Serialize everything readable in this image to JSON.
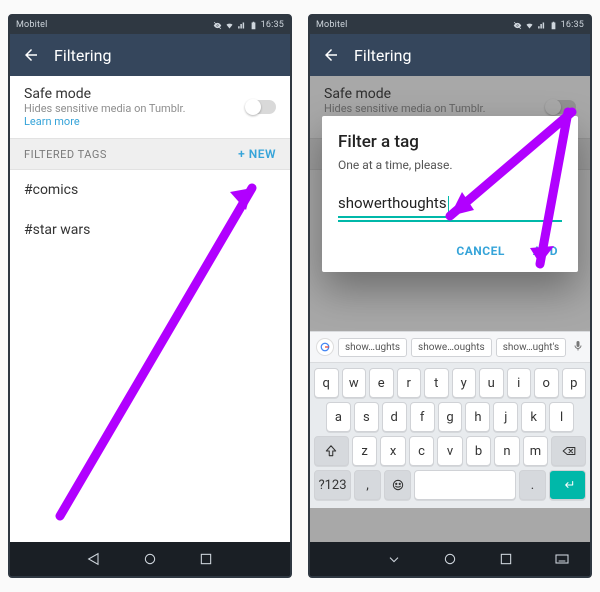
{
  "status": {
    "carrier": "Mobitel",
    "time": "16:35"
  },
  "appbar": {
    "title": "Filtering"
  },
  "safe": {
    "title": "Safe mode",
    "sub": "Hides sensitive media on Tumblr.",
    "learn": "Learn more"
  },
  "section": {
    "header": "FILTERED TAGS",
    "new": "+ NEW"
  },
  "tags": [
    "#comics",
    "#star wars"
  ],
  "dialog": {
    "title": "Filter a tag",
    "sub": "One at a time, please.",
    "value": "showerthoughts",
    "cancel": "CANCEL",
    "add": "ADD"
  },
  "suggest": [
    "show…ughts",
    "showe…oughts",
    "show…ught's"
  ],
  "keys": {
    "sym": "?123",
    "comma": ",",
    "period": "."
  }
}
